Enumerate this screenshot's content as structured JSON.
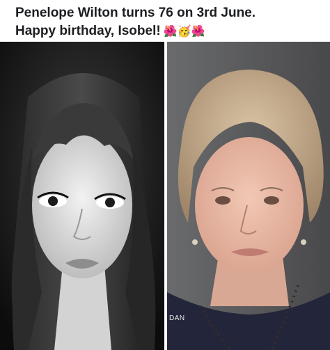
{
  "post": {
    "caption_line1": "Penelope Wilton turns 76 on 3rd June.",
    "caption_line2": "Happy birthday, Isobel!",
    "caption_emojis": "🌺🥳🌺"
  },
  "photos": {
    "left": {
      "icon": "young-portrait-bw",
      "description_visible": false
    },
    "right": {
      "icon": "older-portrait-color",
      "watermark_text": "DAN"
    }
  },
  "colors": {
    "text": "#1c1e21",
    "background": "#ffffff"
  }
}
